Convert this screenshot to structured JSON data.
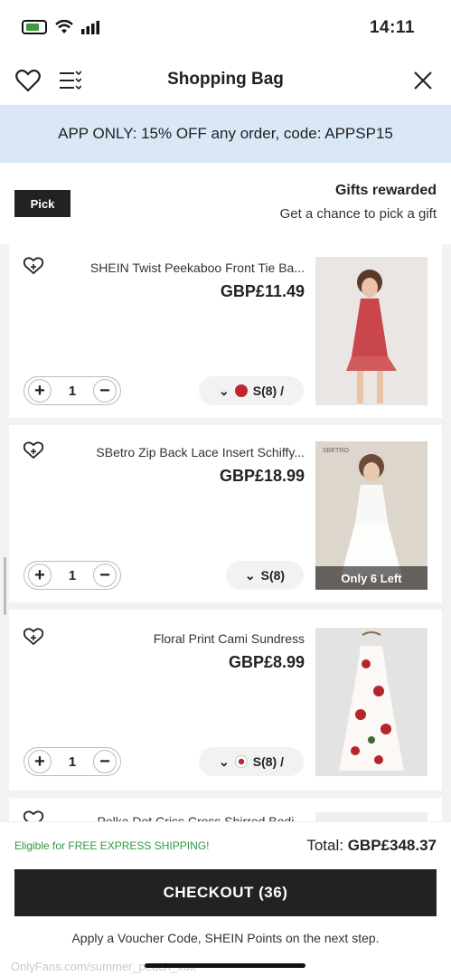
{
  "status": {
    "time": "14:11"
  },
  "header": {
    "title": "Shopping Bag"
  },
  "promo": {
    "text": "APP ONLY: 15% OFF any order, code: APPSP15"
  },
  "gifts": {
    "title": "Gifts rewarded",
    "subtitle": "Get a chance to pick a gift",
    "pick_label": "Pick"
  },
  "items": [
    {
      "name": "SHEIN Twist Peekaboo Front Tie Ba...",
      "price": "GBP£11.49",
      "variant": "S(8) /",
      "qty": "1",
      "swatch_color": "#c0272d"
    },
    {
      "name": "SBetro Zip Back Lace Insert Schiffy...",
      "price": "GBP£18.99",
      "variant": "S(8)",
      "qty": "1",
      "badge": "Only 6 Left",
      "brand_tag": "SBETRO"
    },
    {
      "name": "Floral Print Cami Sundress",
      "price": "GBP£8.99",
      "variant": "S(8) /",
      "qty": "1",
      "swatch_color": "#c0272d"
    },
    {
      "name": "Polka Dot Criss Cross Shirred Bodi..."
    }
  ],
  "footer": {
    "total_label": "Total:",
    "total_value": "GBP£348.37",
    "express": "Eligible for FREE EXPRESS SHIPPING!",
    "checkout": "CHECKOUT (36)",
    "apply": "Apply a Voucher Code, SHEIN Points on the next step.",
    "watermark": "OnlyFans.com/summer_peach_xox"
  },
  "colors": {
    "promo_bg": "#d9e7f6",
    "express_green": "#2e9a3f",
    "checkout_bg": "#222222"
  }
}
